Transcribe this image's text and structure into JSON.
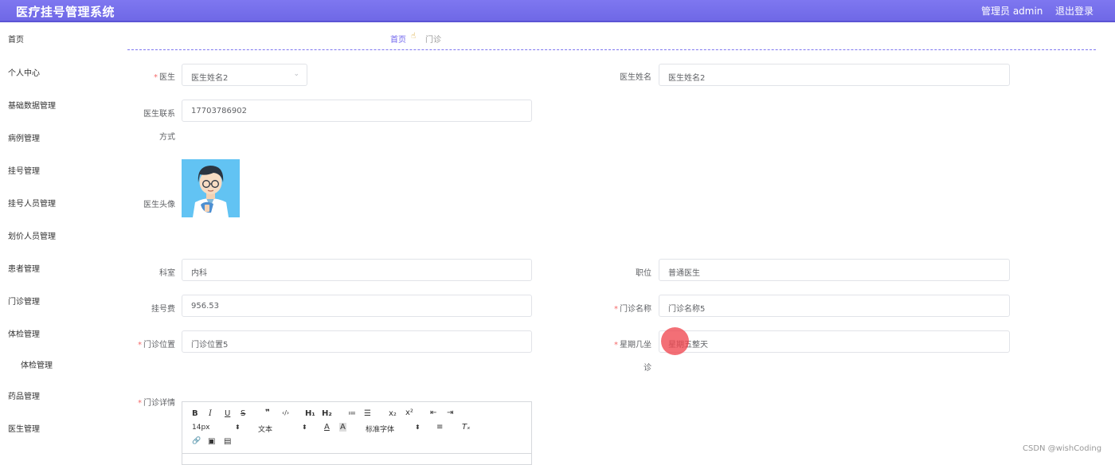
{
  "header": {
    "title": "医疗挂号管理系统",
    "user": "管理员 admin",
    "logout": "退出登录",
    "accent_color": "#7e77f0"
  },
  "sidebar": {
    "items": [
      {
        "label": "首页"
      },
      {
        "label": "个人中心"
      },
      {
        "label": "基础数据管理"
      },
      {
        "label": "病例管理"
      },
      {
        "label": "挂号管理"
      },
      {
        "label": "挂号人员管理"
      },
      {
        "label": "划价人员管理"
      },
      {
        "label": "患者管理"
      },
      {
        "label": "门诊管理"
      },
      {
        "label": "体检管理"
      },
      {
        "label": "体检管理"
      },
      {
        "label": "药品管理"
      },
      {
        "label": "医生管理"
      }
    ]
  },
  "breadcrumb": {
    "home": "首页",
    "separator_icon": "hand-icon",
    "current": "门诊"
  },
  "form": {
    "doctor": {
      "label": "医生",
      "required": "*",
      "value": "医生姓名2"
    },
    "doctor_name": {
      "label": "医生姓名",
      "value": "医生姓名2"
    },
    "doctor_phone": {
      "label": "医生联系",
      "label2": "方式",
      "value": "17703786902"
    },
    "doctor_avatar": {
      "label": "医生头像"
    },
    "department": {
      "label": "科室",
      "value": "内科"
    },
    "position": {
      "label": "职位",
      "value": "普通医生"
    },
    "fee": {
      "label": "挂号费",
      "value": "956.53"
    },
    "clinic_name": {
      "label": "门诊名称",
      "required": "*",
      "value": "门诊名称5"
    },
    "clinic_location": {
      "label": "门诊位置",
      "required": "*",
      "value": "门诊位置5"
    },
    "weekday": {
      "label": "星期几坐",
      "label2": "诊",
      "required": "*",
      "value": "星期五整天"
    },
    "clinic_detail": {
      "label": "门诊详情",
      "required": "*"
    }
  },
  "editor": {
    "font_size": "14px",
    "block_type": "文本",
    "font_family": "标准字体",
    "buttons": {
      "bold": "B",
      "italic": "I",
      "underline": "U",
      "strike": "S",
      "quote": "❞",
      "code": "‹/›",
      "h1": "H₁",
      "h2": "H₂",
      "ordered": "≔",
      "bullet": "☰",
      "sub": "x₂",
      "sup": "x²",
      "outdent": "⇤",
      "indent": "⇥",
      "color": "A",
      "bg": "A",
      "align": "≡",
      "clear": "Tₓ",
      "link": "🔗",
      "image": "▣",
      "video": "▤",
      "arrow": "⬍"
    }
  },
  "watermark": "CSDN @wishCoding"
}
